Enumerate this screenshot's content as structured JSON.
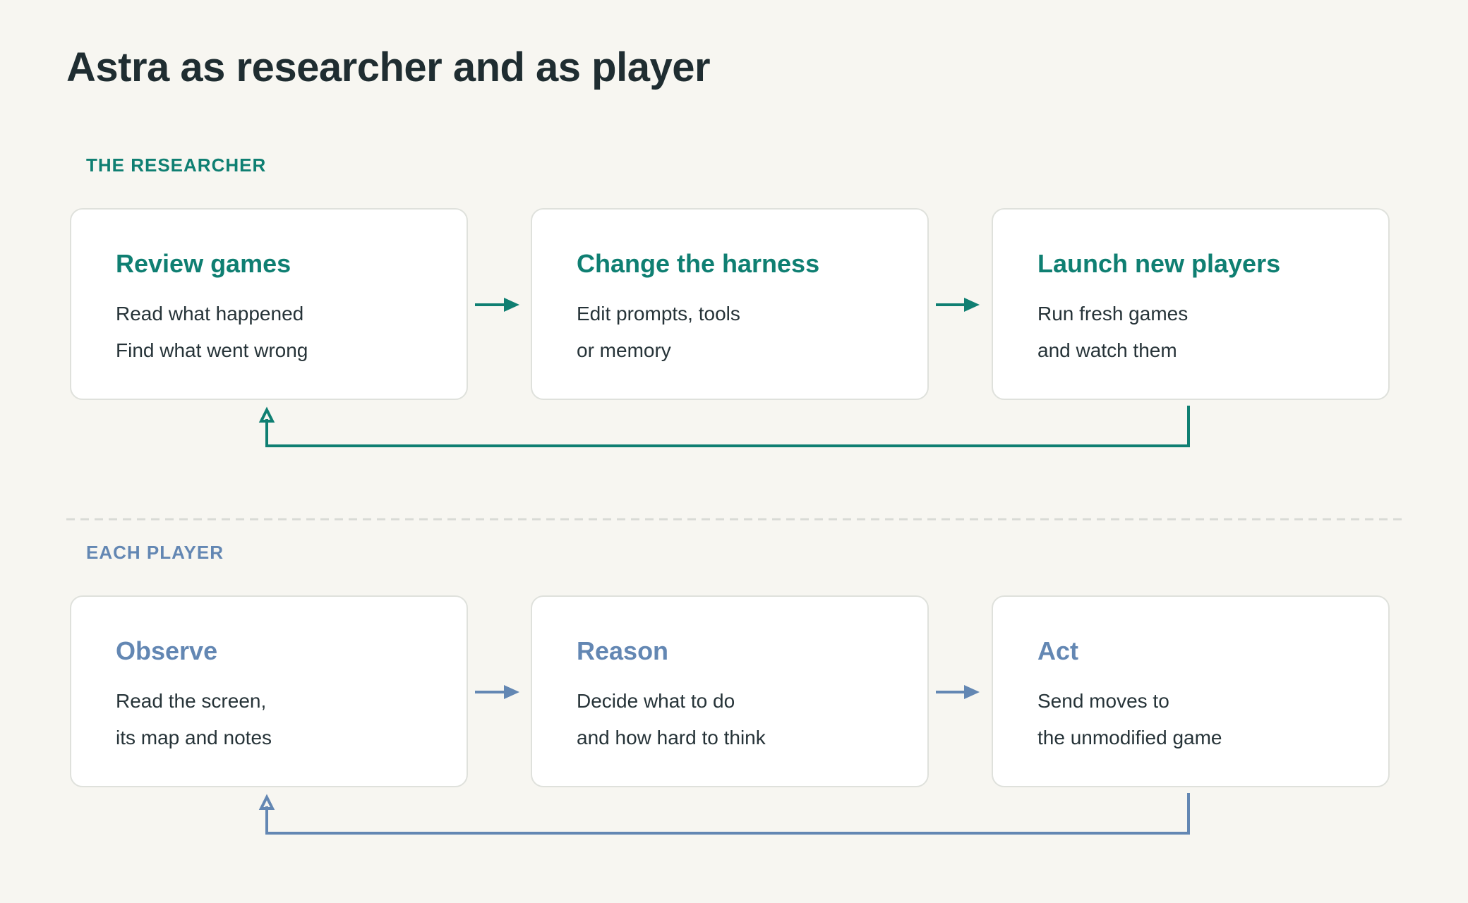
{
  "title": "Astra as researcher and as player",
  "researcher": {
    "label": "THE RESEARCHER",
    "steps": [
      {
        "title": "Review games",
        "lines": [
          "Read what happened",
          "Find what went wrong"
        ]
      },
      {
        "title": "Change the harness",
        "lines": [
          "Edit prompts, tools",
          "or memory"
        ]
      },
      {
        "title": "Launch new players",
        "lines": [
          "Run fresh games",
          "and watch them"
        ]
      }
    ]
  },
  "player": {
    "label": "EACH PLAYER",
    "steps": [
      {
        "title": "Observe",
        "lines": [
          "Read the screen,",
          "its map and notes"
        ]
      },
      {
        "title": "Reason",
        "lines": [
          "Decide what to do",
          "and how hard to think"
        ]
      },
      {
        "title": "Act",
        "lines": [
          "Send moves to",
          "the unmodified game"
        ]
      }
    ]
  },
  "colors": {
    "researcher": "#0f7f72",
    "player": "#6387b3",
    "background": "#f7f6f1",
    "divider": "#d9dbd6"
  }
}
